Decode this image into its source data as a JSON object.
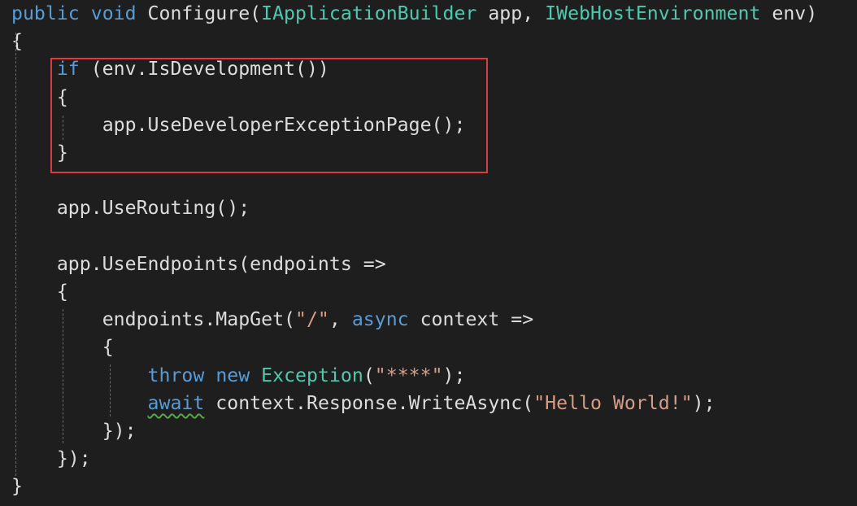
{
  "editor": {
    "lines": [
      {
        "tokens": [
          {
            "t": "public",
            "c": "kw"
          },
          {
            "t": " ",
            "c": "ws"
          },
          {
            "t": "void",
            "c": "kw"
          },
          {
            "t": " Configure(",
            "c": "pl"
          },
          {
            "t": "IApplicationBuilder",
            "c": "ty"
          },
          {
            "t": " app, ",
            "c": "pl"
          },
          {
            "t": "IWebHostEnvironment",
            "c": "ty"
          },
          {
            "t": " env)",
            "c": "pl"
          }
        ]
      },
      {
        "tokens": [
          {
            "t": "{",
            "c": "pl"
          }
        ]
      },
      {
        "tokens": [
          {
            "t": "    ",
            "c": "ws"
          },
          {
            "t": "if",
            "c": "kw"
          },
          {
            "t": " (env.IsDevelopment())",
            "c": "pl"
          }
        ]
      },
      {
        "tokens": [
          {
            "t": "    ",
            "c": "ws"
          },
          {
            "t": "{",
            "c": "pl"
          }
        ]
      },
      {
        "tokens": [
          {
            "t": "        ",
            "c": "ws"
          },
          {
            "t": "app.UseDeveloperExceptionPage();",
            "c": "pl"
          }
        ]
      },
      {
        "tokens": [
          {
            "t": "    ",
            "c": "ws"
          },
          {
            "t": "}",
            "c": "pl"
          }
        ]
      },
      {
        "tokens": []
      },
      {
        "tokens": [
          {
            "t": "    ",
            "c": "ws"
          },
          {
            "t": "app.UseRouting();",
            "c": "pl"
          }
        ]
      },
      {
        "tokens": []
      },
      {
        "tokens": [
          {
            "t": "    ",
            "c": "ws"
          },
          {
            "t": "app.UseEndpoints(endpoints =>",
            "c": "pl"
          }
        ]
      },
      {
        "tokens": [
          {
            "t": "    ",
            "c": "ws"
          },
          {
            "t": "{",
            "c": "pl"
          }
        ]
      },
      {
        "tokens": [
          {
            "t": "        ",
            "c": "ws"
          },
          {
            "t": "endpoints.MapGet(",
            "c": "pl"
          },
          {
            "t": "\"/\"",
            "c": "str"
          },
          {
            "t": ", ",
            "c": "pl"
          },
          {
            "t": "async",
            "c": "kw"
          },
          {
            "t": " context =>",
            "c": "pl"
          }
        ]
      },
      {
        "tokens": [
          {
            "t": "        ",
            "c": "ws"
          },
          {
            "t": "{",
            "c": "pl"
          }
        ]
      },
      {
        "tokens": [
          {
            "t": "            ",
            "c": "ws"
          },
          {
            "t": "throw",
            "c": "kw"
          },
          {
            "t": " ",
            "c": "ws"
          },
          {
            "t": "new",
            "c": "kw"
          },
          {
            "t": " ",
            "c": "ws"
          },
          {
            "t": "Exception",
            "c": "ty"
          },
          {
            "t": "(",
            "c": "pl"
          },
          {
            "t": "\"****\"",
            "c": "str"
          },
          {
            "t": ");",
            "c": "pl"
          }
        ]
      },
      {
        "tokens": [
          {
            "t": "            ",
            "c": "ws"
          },
          {
            "t": "await",
            "c": "kw squiggle"
          },
          {
            "t": " context.Response.WriteAsync(",
            "c": "pl"
          },
          {
            "t": "\"Hello World!\"",
            "c": "str"
          },
          {
            "t": ");",
            "c": "pl"
          }
        ]
      },
      {
        "tokens": [
          {
            "t": "        ",
            "c": "ws"
          },
          {
            "t": "});",
            "c": "pl"
          }
        ]
      },
      {
        "tokens": [
          {
            "t": "    ",
            "c": "ws"
          },
          {
            "t": "});",
            "c": "pl"
          }
        ]
      },
      {
        "tokens": [
          {
            "t": "}",
            "c": "pl"
          }
        ]
      }
    ]
  },
  "colors": {
    "background": "#1e1e1e",
    "keyword": "#569cd6",
    "type": "#4ec9b0",
    "string": "#d69d85",
    "plain": "#dcdcdc",
    "highlight_border": "#e0393e",
    "squiggle": "#57a64a"
  }
}
